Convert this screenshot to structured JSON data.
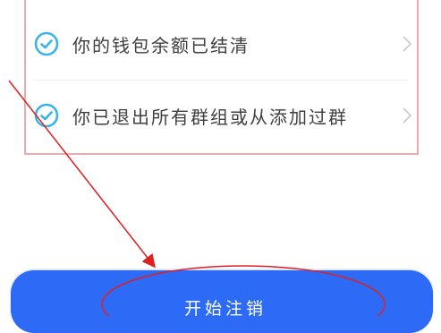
{
  "checklist": {
    "items": [
      {
        "label": "你的钱包余额已结清",
        "status": "checked"
      },
      {
        "label": "你已退出所有群组或从添加过群",
        "status": "checked"
      }
    ]
  },
  "primary_action": {
    "label": "开始注销"
  },
  "colors": {
    "accent": "#2d6af5",
    "check": "#3bb3e8",
    "annotation": "#e02020",
    "box_border": "#f2a9a9"
  }
}
